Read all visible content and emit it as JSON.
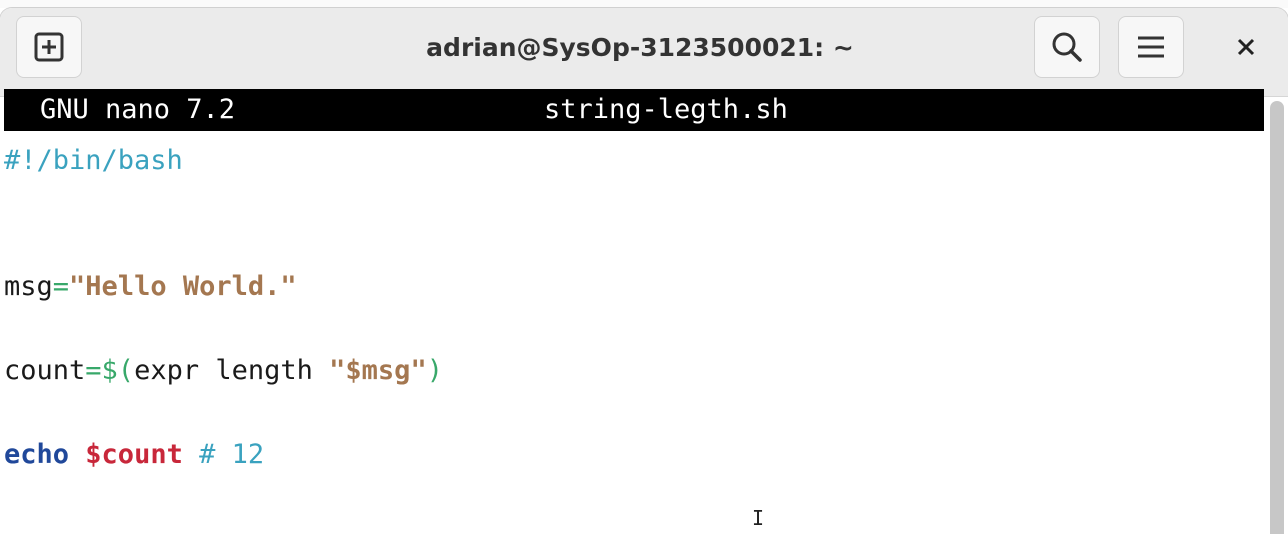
{
  "window": {
    "title": "adrian@SysOp-3123500021: ~"
  },
  "icons": {
    "new_tab": "new-tab-icon",
    "search": "search-icon",
    "menu": "hamburger-menu-icon",
    "close": "close-icon"
  },
  "nano": {
    "version": "GNU nano 7.2",
    "filename": "string-legth.sh"
  },
  "code": {
    "shebang": "#!/bin/bash",
    "line_msg": {
      "name": "msg",
      "op": "=",
      "value": "\"Hello World.\""
    },
    "line_count": {
      "name": "count",
      "op": "=$(",
      "cmd": "expr length ",
      "q1": "\"",
      "arg": "$msg",
      "q2": "\"",
      "close": ")"
    },
    "line_echo": {
      "kw": "echo",
      "var": "$count",
      "comment": "# 12"
    }
  },
  "colors": {
    "shebang": "#3aa2bf",
    "string": "#a47750",
    "keyword": "#20489a",
    "variable": "#c8273a",
    "operator": "#38a86a",
    "nano_bar_bg": "#000000"
  }
}
